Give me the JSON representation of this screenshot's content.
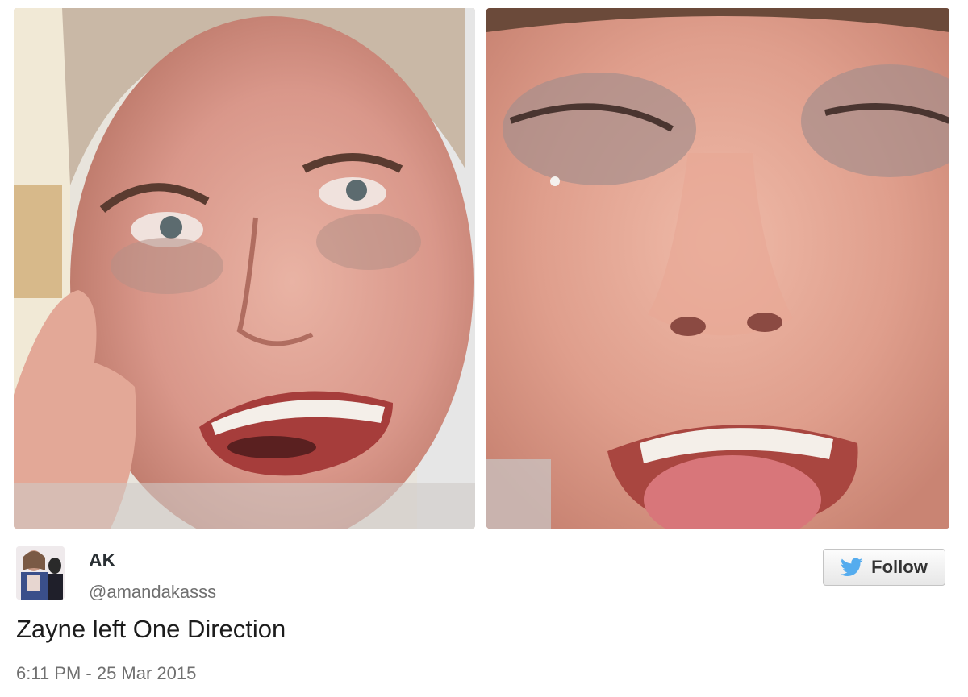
{
  "tweet": {
    "display_name": "AK",
    "handle": "@amandakasss",
    "text": "Zayne left One Direction",
    "timestamp": "6:11 PM - 25 Mar 2015",
    "follow_label": "Follow"
  },
  "icons": {
    "follow": "twitter-bird-icon"
  },
  "colors": {
    "brand_blue": "#55acee",
    "name_text": "#292f33",
    "secondary_text": "#707070"
  }
}
